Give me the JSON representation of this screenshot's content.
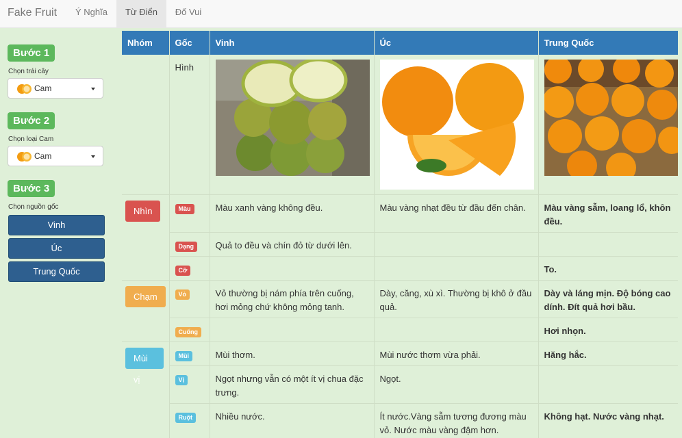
{
  "navbar": {
    "brand": "Fake Fruit",
    "tabs": [
      "Ý Nghĩa",
      "Từ Điển",
      "Đố Vui"
    ],
    "active_tab": "Từ Điển"
  },
  "sidebar": {
    "step1": {
      "label": "Bước 1",
      "caption": "Chọn trái cây",
      "value": "Cam"
    },
    "step2": {
      "label": "Bước 2",
      "caption": "Chọn loại Cam",
      "value": "Cam"
    },
    "step3": {
      "label": "Bước 3",
      "caption": "Chọn nguồn gốc",
      "buttons": [
        "Vinh",
        "Úc",
        "Trung Quốc"
      ]
    }
  },
  "table": {
    "headers": [
      "Nhóm",
      "Gốc",
      "Vinh",
      "Úc",
      "Trung Quốc"
    ],
    "image_row_label": "Hình",
    "groups": [
      {
        "name": "Nhìn",
        "color": "#d9534f",
        "rows": [
          {
            "attr": "Màu",
            "vinh": "Màu xanh vàng không đều.",
            "uc": "Màu vàng nhạt đều từ đầu đến chân.",
            "tq": "Màu vàng sẫm, loang lổ, khôn đều."
          },
          {
            "attr": "Dạng",
            "vinh": "Quả to đều và chín đỏ từ dưới lên.",
            "uc": "",
            "tq": ""
          },
          {
            "attr": "Cỡ",
            "vinh": "",
            "uc": "",
            "tq": "To."
          }
        ]
      },
      {
        "name": "Chạm",
        "color": "#f0ad4e",
        "rows": [
          {
            "attr": "Vỏ",
            "vinh": "Vỏ thường bị nám phía trên cuống, hơi mỏng chứ không mỏng tanh.",
            "uc": "Dày, căng, xù xì. Thường bị khô ở đầu quả.",
            "tq": "Dày và láng mịn. Độ bóng cao dính. Đít quả hơi bầu."
          },
          {
            "attr": "Cuống",
            "vinh": "",
            "uc": "",
            "tq": "Hơi nhọn."
          }
        ]
      },
      {
        "name": "Mùi vị",
        "color": "#5bc0de",
        "rows": [
          {
            "attr": "Mùi",
            "vinh": "Mùi thơm.",
            "uc": "Mùi nước thơm vừa phải.",
            "tq": "Hăng hắc."
          },
          {
            "attr": "Vị",
            "vinh": "Ngọt nhưng vẫn có một ít vị chua đặc trưng.",
            "uc": "Ngọt.",
            "tq": ""
          },
          {
            "attr": "Ruột",
            "vinh": "Nhiều nước.",
            "uc": "Ít nước.Vàng sẫm tương đương màu vỏ. Nước màu vàng đậm hơn.",
            "tq": "Không hạt. Nước vàng nhạt."
          }
        ]
      }
    ]
  }
}
